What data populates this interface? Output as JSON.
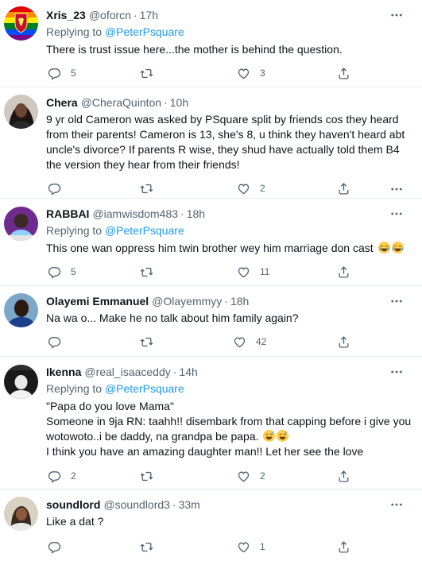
{
  "tweets": [
    {
      "name": "Xris_23",
      "handle": "@oforcn",
      "time": "17h",
      "replying_prefix": "Replying to ",
      "replying_to": "@PeterPsquare",
      "text": "There is trust issue here...the mother is behind the question.",
      "replies": "5",
      "retweets": "",
      "likes": "3"
    },
    {
      "name": "Chera",
      "handle": "@CheraQuinton",
      "time": "10h",
      "text": "9 yr old Cameron was asked by PSquare split by friends cos they heard from their parents! Cameron is 13, she's 8, u think they haven't heard abt uncle's divorce? If parents R wise, they shud have actually told them B4 the version they hear from their friends!",
      "replies": "",
      "retweets": "",
      "likes": "2"
    },
    {
      "name": "RABBAI",
      "handle": "@iamwisdom483",
      "time": "18h",
      "replying_prefix": "Replying to ",
      "replying_to": "@PeterPsquare",
      "text": "This one wan oppress him twin brother wey him marriage don cast",
      "replies": "5",
      "retweets": "",
      "likes": "11"
    },
    {
      "name": "Olayemi Emmanuel",
      "handle": "@Olayemmyy",
      "time": "18h",
      "text": "Na wa o... Make he no talk about him family again?",
      "replies": "",
      "retweets": "",
      "likes": "42"
    },
    {
      "name": "Ikenna",
      "handle": "@real_isaaceddy",
      "time": "14h",
      "replying_prefix": "Replying to ",
      "replying_to": "@PeterPsquare",
      "text_lines": [
        "\"Papa do you love Mama\"",
        "Someone in 9ja RN: taahh!! disembark from that capping before i give you wotowoto..i be daddy, na grandpa be papa.",
        "I think you have an amazing daughter man!! Let her see the love"
      ],
      "replies": "2",
      "retweets": "",
      "likes": "2"
    },
    {
      "name": "soundlord",
      "handle": "@soundlord3",
      "time": "33m",
      "text": "Like a dat ?",
      "replies": "",
      "retweets": "",
      "likes": "1"
    }
  ],
  "separator": "·",
  "icons": [
    "more-icon",
    "reply-icon",
    "retweet-icon",
    "like-icon",
    "share-icon"
  ],
  "colors": {
    "link": "#1d9bf0",
    "secondary": "#536471",
    "text": "#0f1419",
    "divider": "#e6ecf0"
  }
}
